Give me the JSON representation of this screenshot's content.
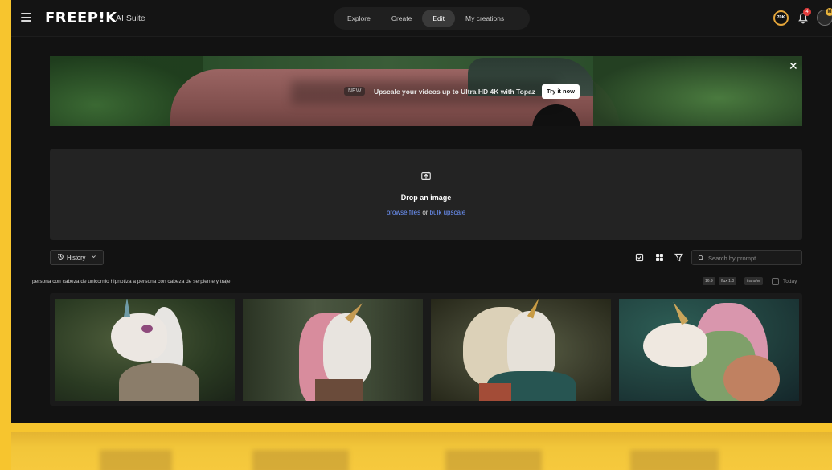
{
  "brand": {
    "logo": "FREEP!K",
    "suffix": "AI Suite"
  },
  "nav": {
    "tabs": [
      {
        "label": "Explore",
        "active": false
      },
      {
        "label": "Create",
        "active": false
      },
      {
        "label": "Edit",
        "active": true
      },
      {
        "label": "My creations",
        "active": false
      }
    ]
  },
  "header": {
    "credits": "70K",
    "notification_count": "4",
    "avatar_badge": "M"
  },
  "banner": {
    "badge": "NEW",
    "text": "Upscale your videos up to Ultra HD 4K with Topaz",
    "cta": "Try it now",
    "close": "✕"
  },
  "dropzone": {
    "title": "Drop an image",
    "browse_link": "browse files",
    "separator": "or",
    "bulk_link": "bulk upscale"
  },
  "toolbar": {
    "history_label": "History",
    "search_placeholder": "Search by prompt"
  },
  "generation": {
    "prompt": "persona con cabeza de unicornio hipnotiza a persona con cabeza de serpiente y traje",
    "tags": [
      "16:9",
      "flux 1.0",
      "transfer"
    ],
    "date": "Today"
  },
  "colors": {
    "accent_link": "#6f96ff",
    "background": "#121212",
    "frame": "#f7c52e"
  }
}
